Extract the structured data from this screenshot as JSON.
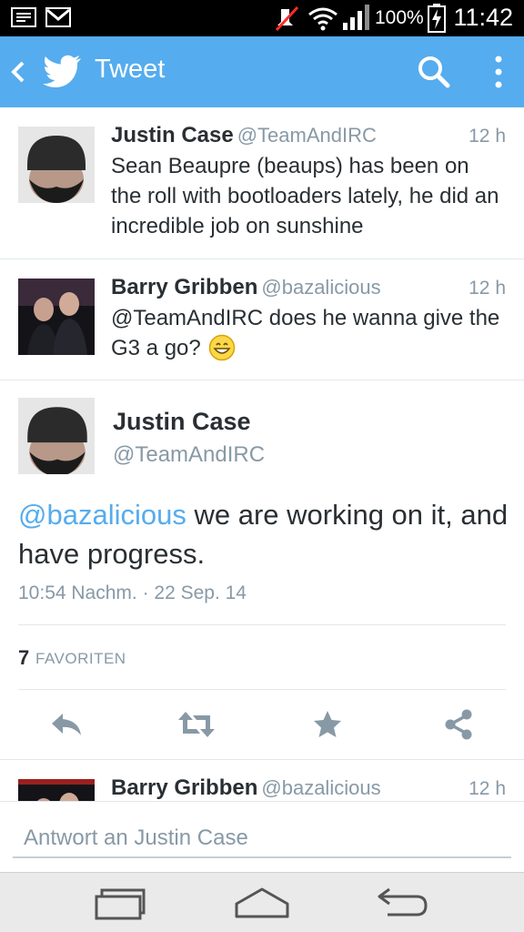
{
  "status_bar": {
    "icons": [
      "message-icon",
      "gmail-icon",
      "mute-icon",
      "wifi-icon",
      "signal-icon",
      "battery-charging-icon"
    ],
    "battery": "100%",
    "time": "11:42"
  },
  "app_bar": {
    "title": "Tweet",
    "color": "#55acee",
    "icons": [
      "back-icon",
      "twitter-bird-icon",
      "search-icon",
      "overflow-menu-icon"
    ]
  },
  "tweets": [
    {
      "name": "Justin Case",
      "handle": "@TeamAndIRC",
      "time": "12 h",
      "text": "Sean Beaupre (beaups) has been on the roll with bootloaders lately, he did an incredible job on sunshine"
    },
    {
      "name": "Barry Gribben",
      "handle": "@bazalicious",
      "time": "12 h",
      "text": "@TeamAndIRC does he wanna give the G3 a go?",
      "emoji": "grin-emoji"
    }
  ],
  "focused_tweet": {
    "name": "Justin Case",
    "handle": "@TeamAndIRC",
    "mention": "@bazalicious",
    "text": " we are working on it, and have progress.",
    "timestamp": "10:54 Nachm. · 22 Sep. 14",
    "favorites_count": "7",
    "favorites_label": "FAVORITEN",
    "actions": [
      "reply-icon",
      "retweet-icon",
      "favorite-icon",
      "share-icon"
    ]
  },
  "next_tweet": {
    "name": "Barry Gribben",
    "handle": "@bazalicious",
    "time": "12 h"
  },
  "reply": {
    "placeholder": "Antwort an Justin Case"
  },
  "nav_bar": {
    "icons": [
      "recent-apps-icon",
      "home-icon",
      "back-nav-icon"
    ]
  },
  "colors": {
    "accent": "#55acee",
    "text": "#292f33",
    "muted": "#8899a6",
    "divider": "#e1e8ed"
  }
}
